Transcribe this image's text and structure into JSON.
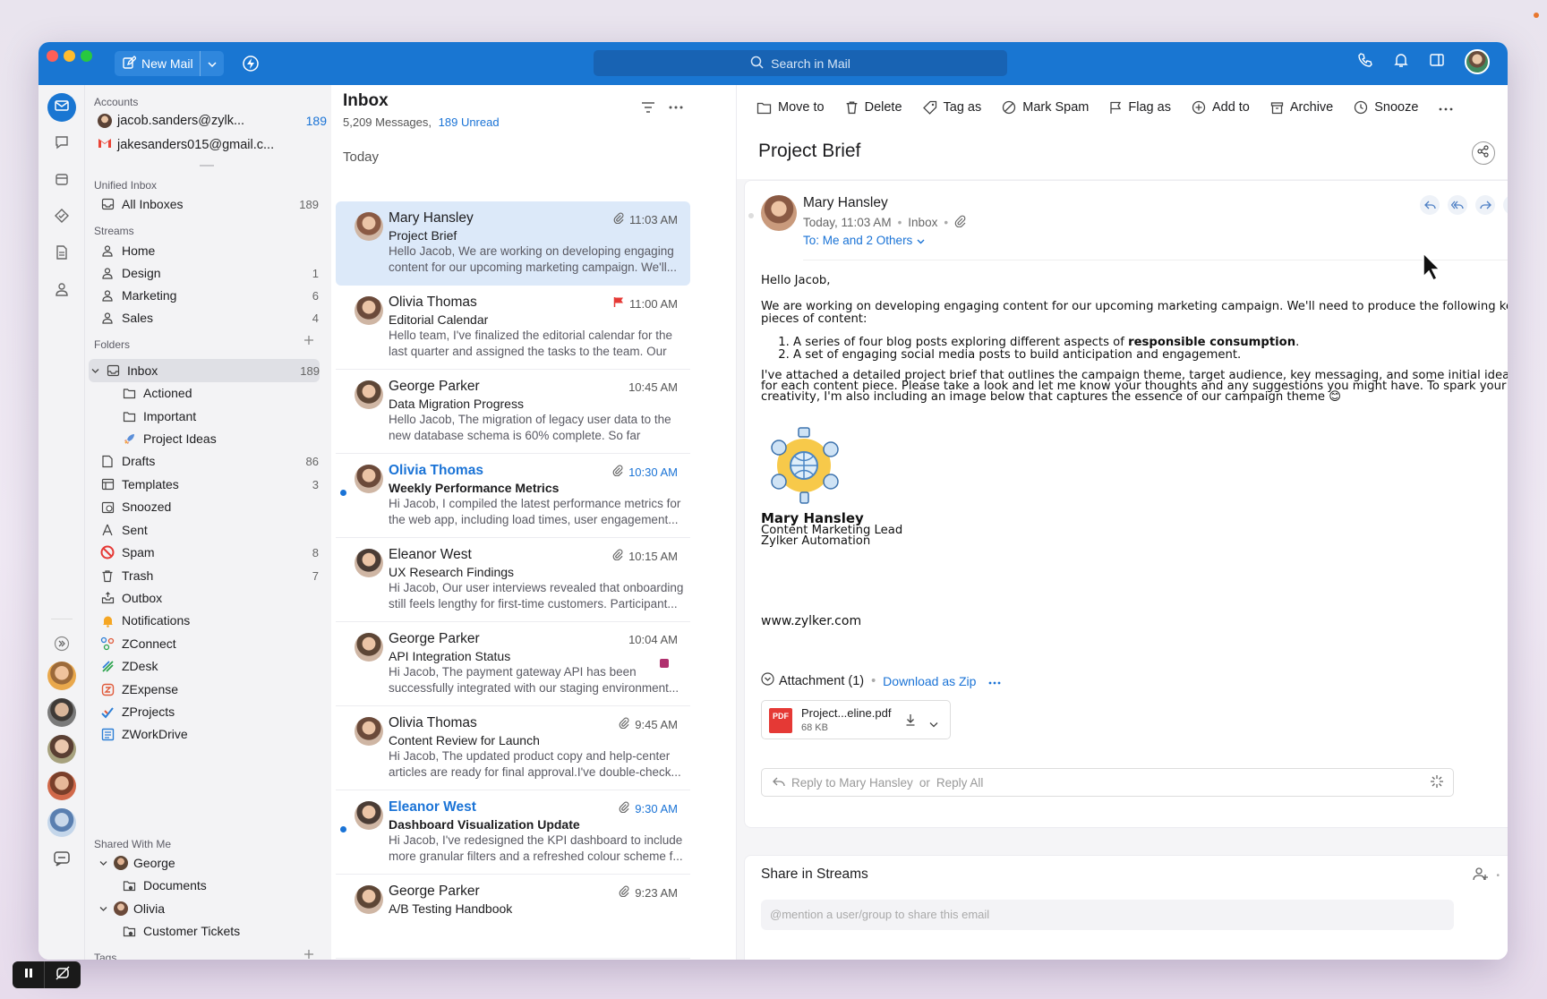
{
  "titlebar": {
    "new_mail_label": "New Mail",
    "search_placeholder": "Search in Mail"
  },
  "sidebar": {
    "accounts_label": "Accounts",
    "accounts": [
      {
        "email": "jacob.sanders@zylk...",
        "count": "189"
      },
      {
        "email": "jakesanders015@gmail.c..."
      }
    ],
    "unified_label": "Unified Inbox",
    "all_inboxes": {
      "label": "All Inboxes",
      "count": "189"
    },
    "streams_label": "Streams",
    "streams": [
      {
        "label": "Home",
        "count": ""
      },
      {
        "label": "Design",
        "count": "1"
      },
      {
        "label": "Marketing",
        "count": "6"
      },
      {
        "label": "Sales",
        "count": "4"
      }
    ],
    "folders_label": "Folders",
    "folders": [
      {
        "label": "Inbox",
        "count": "189",
        "icon": "inbox-icon"
      },
      {
        "label": "Actioned",
        "count": "",
        "icon": "folder-icon"
      },
      {
        "label": "Important",
        "count": "",
        "icon": "folder-icon"
      },
      {
        "label": "Project Ideas",
        "count": "",
        "icon": "rocket-icon"
      },
      {
        "label": "Drafts",
        "count": "86",
        "icon": "draft-icon"
      },
      {
        "label": "Templates",
        "count": "3",
        "icon": "template-icon"
      },
      {
        "label": "Snoozed",
        "count": "",
        "icon": "snooze-icon"
      },
      {
        "label": "Sent",
        "count": "",
        "icon": "sent-icon"
      },
      {
        "label": "Spam",
        "count": "8",
        "icon": "spam-icon"
      },
      {
        "label": "Trash",
        "count": "7",
        "icon": "trash-icon"
      },
      {
        "label": "Outbox",
        "count": "",
        "icon": "outbox-icon"
      },
      {
        "label": "Notifications",
        "count": "",
        "icon": "bell-icon"
      },
      {
        "label": "ZConnect",
        "count": "",
        "icon": "zconnect-icon"
      },
      {
        "label": "ZDesk",
        "count": "",
        "icon": "zdesk-icon"
      },
      {
        "label": "ZExpense",
        "count": "",
        "icon": "zexpense-icon"
      },
      {
        "label": "ZProjects",
        "count": "",
        "icon": "zprojects-icon"
      },
      {
        "label": "ZWorkDrive",
        "count": "",
        "icon": "zworkdrive-icon"
      }
    ],
    "shared_label": "Shared With Me",
    "shared": [
      {
        "label": "George",
        "child": "Documents"
      },
      {
        "label": "Olivia",
        "child": "Customer Tickets"
      }
    ],
    "tags_label": "Tags"
  },
  "list": {
    "title": "Inbox",
    "count_text": "5,209 Messages,",
    "unread_text": "189 Unread",
    "group_label": "Today",
    "mails": [
      {
        "from": "Mary Hansley",
        "subject": "Project Brief",
        "preview": "Hello Jacob, We are working on developing engaging content for our upcoming marketing campaign. We'll...",
        "time": "11:03 AM",
        "attach": true,
        "unread": false,
        "selected": true,
        "flag": false,
        "tag": false,
        "av_color": "#8a5a44"
      },
      {
        "from": "Olivia Thomas",
        "subject": "Editorial Calendar",
        "preview": "Hello team, I've finalized the editorial calendar for the last quarter and assigned the tasks to the team. Our e...",
        "time": "11:00 AM",
        "attach": false,
        "unread": false,
        "selected": false,
        "flag": true,
        "tag": false,
        "av_color": "#6b4a3a"
      },
      {
        "from": "George Parker",
        "subject": "Data Migration Progress",
        "preview": "Hello Jacob, The migration of legacy user data to the new database schema is 60% complete. So far we've...",
        "time": "10:45 AM",
        "attach": false,
        "unread": false,
        "selected": false,
        "flag": false,
        "tag": false,
        "av_color": "#5d4636"
      },
      {
        "from": "Olivia Thomas",
        "subject": "Weekly Performance Metrics",
        "preview": "Hi Jacob, I compiled the latest performance metrics for the web app, including load times, user engagement...",
        "time": "10:30 AM",
        "attach": true,
        "unread": true,
        "selected": false,
        "flag": false,
        "tag": false,
        "av_color": "#6b4a3a"
      },
      {
        "from": "Eleanor West",
        "subject": "UX Research Findings",
        "preview": "Hi Jacob, Our user interviews revealed that onboarding still feels lengthy for first-time customers. Participant...",
        "time": "10:15 AM",
        "attach": true,
        "unread": false,
        "selected": false,
        "flag": false,
        "tag": false,
        "av_color": "#4a3c35"
      },
      {
        "from": "George Parker",
        "subject": "API Integration Status",
        "preview": "Hi Jacob, The payment gateway API has been successfully integrated with our staging environment...",
        "time": "10:04 AM",
        "attach": false,
        "unread": false,
        "selected": false,
        "flag": false,
        "tag": true,
        "av_color": "#5d4636"
      },
      {
        "from": "Olivia Thomas",
        "subject": "Content Review for Launch",
        "preview": "Hi Jacob, The updated product copy and help-center articles are ready for final approval.I've double-check...",
        "time": "9:45 AM",
        "attach": true,
        "unread": false,
        "selected": false,
        "flag": false,
        "tag": false,
        "av_color": "#6b4a3a"
      },
      {
        "from": "Eleanor West",
        "subject": "Dashboard Visualization Update",
        "preview": "Hi Jacob, I've redesigned the KPI dashboard to include more granular filters and a refreshed colour scheme f...",
        "time": "9:30 AM",
        "attach": true,
        "unread": true,
        "selected": false,
        "flag": false,
        "tag": false,
        "av_color": "#4a3c35"
      },
      {
        "from": "George Parker",
        "subject": "A/B Testing Handbook",
        "preview": "",
        "time": "9:23 AM",
        "attach": true,
        "unread": false,
        "selected": false,
        "flag": false,
        "tag": false,
        "av_color": "#5d4636"
      }
    ]
  },
  "reader": {
    "actions": [
      {
        "label": "Move to",
        "icon": "folder-icon"
      },
      {
        "label": "Delete",
        "icon": "trash-icon"
      },
      {
        "label": "Tag as",
        "icon": "tag-icon"
      },
      {
        "label": "Mark Spam",
        "icon": "spam-icon"
      },
      {
        "label": "Flag as",
        "icon": "flag-icon"
      },
      {
        "label": "Add to",
        "icon": "plus-circle-icon"
      },
      {
        "label": "Archive",
        "icon": "archive-icon"
      },
      {
        "label": "Snooze",
        "icon": "clock-icon"
      }
    ],
    "subject": "Project Brief",
    "sender": "Mary Hansley",
    "meta_time": "Today, 11:03 AM",
    "meta_folder": "Inbox",
    "to_text": "To: Me and 2 Others",
    "body": {
      "greeting": "Hello Jacob,",
      "para1": "We are working on developing engaging content for our upcoming marketing campaign. We'll need to produce the following key pieces of content:",
      "item1_pre": "A series of four blog posts exploring different aspects of ",
      "item1_bold": "responsible consumption",
      "item1_post": ".",
      "item2": "A set of engaging social media posts to build anticipation and engagement.",
      "para2": "I've attached a detailed project brief that outlines the campaign theme, target audience, key messaging, and some initial ideas for each content piece. Please take a look and let me know your thoughts and any suggestions you might have. To spark your creativity, I'm also including an image below that captures the essence of our campaign theme 😊",
      "sig_name": "Mary Hansley",
      "sig_title": "Content Marketing Lead",
      "sig_company": "Zylker Automation",
      "website": "www.zylker.com"
    },
    "attachment_label": "Attachment (1)",
    "download_zip": "Download as Zip",
    "file_name": "Project...eline.pdf",
    "file_size": "68 KB",
    "file_badge": "PDF",
    "reply_placeholder": "Reply to Mary Hansley",
    "reply_or": "or",
    "reply_all": "Reply All",
    "share_title": "Share in Streams",
    "share_placeholder": "@mention a user/group to share this email"
  },
  "colors": {
    "accent": "#1976d2",
    "unread": "#1a73d6",
    "selected_row": "#dce9f9"
  }
}
